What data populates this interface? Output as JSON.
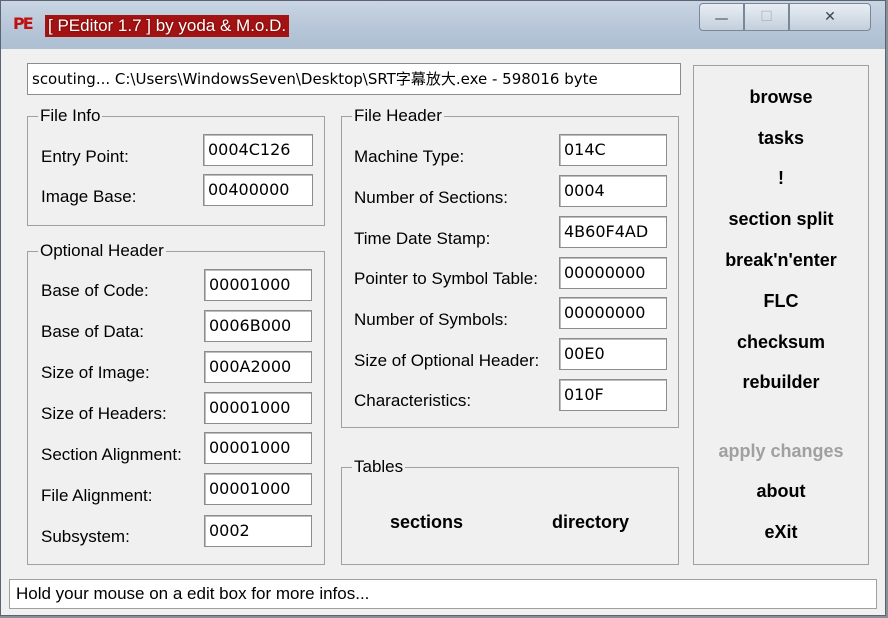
{
  "title": "[ PEditor 1.7 ]  by yoda & M.o.D.",
  "icons": {
    "app": "pe-app-icon",
    "minimize": "minimize-icon",
    "maximize": "maximize-icon",
    "close": "close-icon"
  },
  "window_buttons": {
    "minimize": "—",
    "maximize": "☐",
    "close": "✕"
  },
  "path": "scouting... C:\\Users\\WindowsSeven\\Desktop\\SRT字幕放大.exe - 598016 byte",
  "file_info": {
    "title": "File Info",
    "entry_point_label": "Entry Point:",
    "entry_point": "0004C126",
    "image_base_label": "Image Base:",
    "image_base": "00400000"
  },
  "optional_header": {
    "title": "Optional Header",
    "rows": [
      {
        "label": "Base of Code:",
        "value": "00001000"
      },
      {
        "label": "Base of Data:",
        "value": "0006B000"
      },
      {
        "label": "Size of Image:",
        "value": "000A2000"
      },
      {
        "label": "Size of Headers:",
        "value": "00001000"
      },
      {
        "label": "Section Alignment:",
        "value": "00001000"
      },
      {
        "label": "File Alignment:",
        "value": "00001000"
      },
      {
        "label": "Subsystem:",
        "value": "0002"
      }
    ]
  },
  "file_header": {
    "title": "File Header",
    "rows": [
      {
        "label": "Machine Type:",
        "value": "014C"
      },
      {
        "label": "Number of Sections:",
        "value": "0004"
      },
      {
        "label": "Time Date Stamp:",
        "value": "4B60F4AD"
      },
      {
        "label": "Pointer to Symbol Table:",
        "value": "00000000"
      },
      {
        "label": "Number of Symbols:",
        "value": "00000000"
      },
      {
        "label": "Size of Optional Header:",
        "value": "00E0"
      },
      {
        "label": "Characteristics:",
        "value": "010F"
      }
    ]
  },
  "tables": {
    "title": "Tables",
    "sections": "sections",
    "directory": "directory"
  },
  "menu": {
    "browse": "browse",
    "tasks": "tasks",
    "bang": "!",
    "section_split": "section split",
    "break_n_enter": "break'n'enter",
    "flc": "FLC",
    "checksum": "checksum",
    "rebuilder": "rebuilder",
    "apply_changes": "apply changes",
    "about": "about",
    "exit": "eXit"
  },
  "status": "Hold your mouse on a edit box for more infos..."
}
